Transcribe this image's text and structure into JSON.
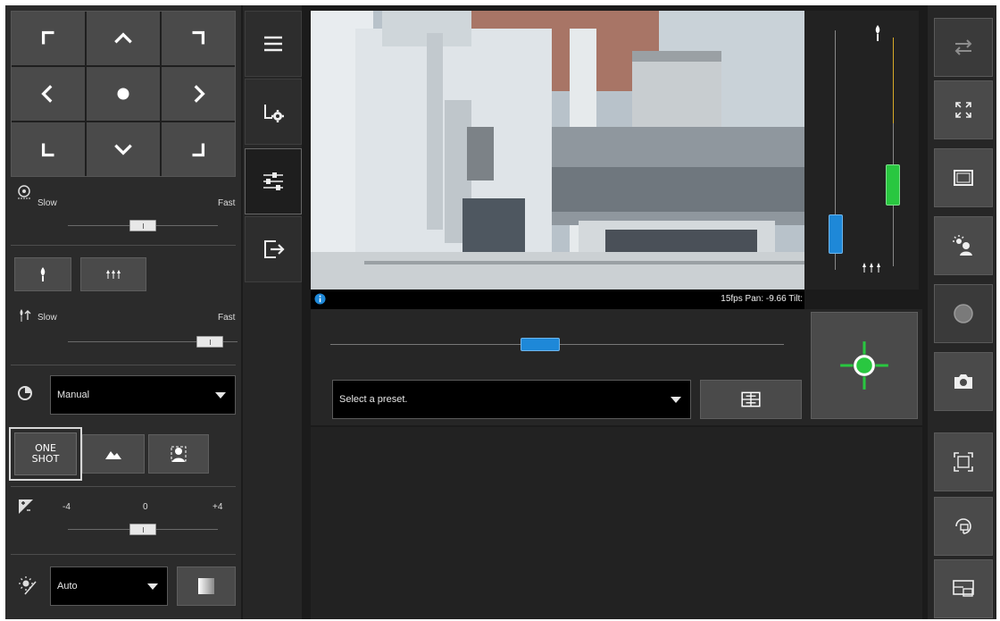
{
  "left": {
    "pan_speed": {
      "icon": "pan-speed-icon",
      "slow": "Slow",
      "fast": "Fast",
      "level": 0.5
    },
    "zoom": {
      "icon": "zoom-speed-icon",
      "slow": "Slow",
      "fast": "Fast",
      "level": 0.9
    },
    "focus_mode": {
      "selected": "Manual"
    },
    "one_shot_label_1": "ONE",
    "one_shot_label_2": "SHOT",
    "exposure": {
      "min": "-4",
      "mid": "0",
      "max": "+4",
      "level": 0.5
    },
    "white_balance": {
      "selected": "Auto"
    }
  },
  "video": {
    "status_text": "15fps Pan: -9.66 Tilt:"
  },
  "center": {
    "preset": {
      "placeholder": "Select a preset."
    },
    "zoom_level": 0.46
  },
  "colors": {
    "accent_blue": "#1e88d8",
    "accent_green": "#29c740",
    "panel": "#2b2b2b"
  }
}
